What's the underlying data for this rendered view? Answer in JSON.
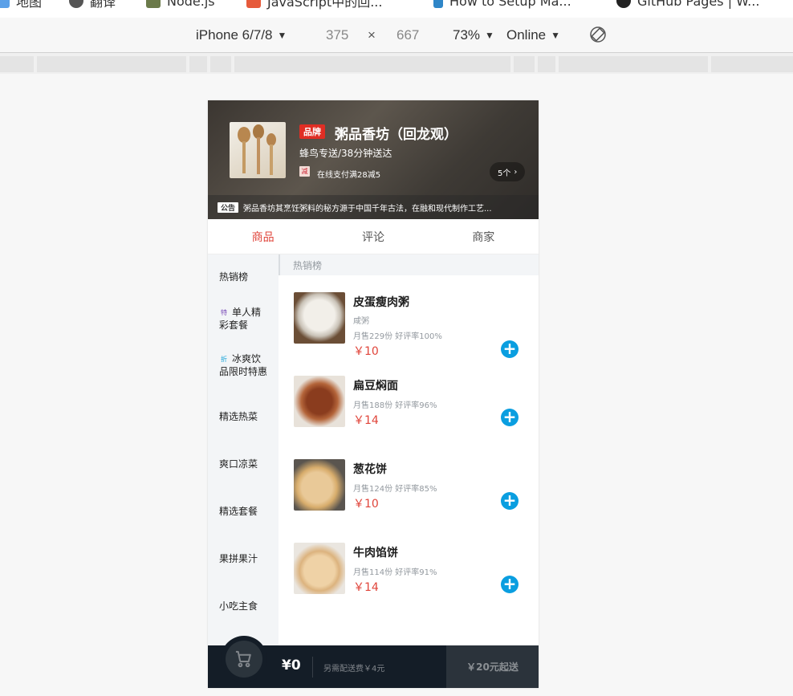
{
  "bookmarks": [
    {
      "label": "地图",
      "icon": "map-icon"
    },
    {
      "label": "翻译",
      "icon": "translate-icon"
    },
    {
      "label": "Node.js",
      "icon": "node-icon"
    },
    {
      "label": "JavaScript中的回...",
      "icon": "js-icon"
    },
    {
      "label": "How to Setup Ma...",
      "icon": "bookmark-icon"
    },
    {
      "label": "GitHub Pages | W...",
      "icon": "github-icon"
    }
  ],
  "device_toolbar": {
    "device": "iPhone 6/7/8",
    "width": "375",
    "times": "×",
    "height": "667",
    "zoom": "73%",
    "network": "Online"
  },
  "seller": {
    "brand_badge": "品牌",
    "name": "粥品香坊（回龙观）",
    "delivery": "蜂鸟专送/38分钟送达",
    "support_icon": "减",
    "support_text": "在线支付满28减5",
    "support_count": "5个",
    "bulletin_tag": "公告",
    "bulletin": "粥品香坊其烹饪粥料的秘方源于中国千年古法，在融和现代制作工艺..."
  },
  "tabs": [
    {
      "label": "商品",
      "active": true
    },
    {
      "label": "评论",
      "active": false
    },
    {
      "label": "商家",
      "active": false
    }
  ],
  "menu": [
    {
      "label": "热销榜",
      "tag": "",
      "tag_type": ""
    },
    {
      "label": "单人精彩套餐",
      "tag": "特",
      "tag_type": "special"
    },
    {
      "label": "冰爽饮品限时特惠",
      "tag": "折",
      "tag_type": "discount"
    },
    {
      "label": "精选热菜",
      "tag": "",
      "tag_type": ""
    },
    {
      "label": "爽口凉菜",
      "tag": "",
      "tag_type": ""
    },
    {
      "label": "精选套餐",
      "tag": "",
      "tag_type": ""
    },
    {
      "label": "果拼果汁",
      "tag": "",
      "tag_type": ""
    },
    {
      "label": "小吃主食",
      "tag": "",
      "tag_type": ""
    }
  ],
  "foods_title": "热销榜",
  "foods": [
    {
      "name": "皮蛋瘦肉粥",
      "desc": "咸粥",
      "sales": "月售229份 好评率100%",
      "price": "￥10"
    },
    {
      "name": "扁豆焖面",
      "desc": "",
      "sales": "月售188份 好评率96%",
      "price": "￥14"
    },
    {
      "name": "葱花饼",
      "desc": "",
      "sales": "月售124份 好评率85%",
      "price": "￥10"
    },
    {
      "name": "牛肉馅饼",
      "desc": "",
      "sales": "月售114份 好评率91%",
      "price": "￥14"
    }
  ],
  "cart": {
    "total": "¥0",
    "fee": "另需配送费￥4元",
    "pay": "￥20元起送"
  },
  "colors": {
    "accent": "#e0443a",
    "add_button": "#0a9ee0",
    "cart_bg": "#141d27",
    "menu_bg": "#f3f5f7"
  }
}
